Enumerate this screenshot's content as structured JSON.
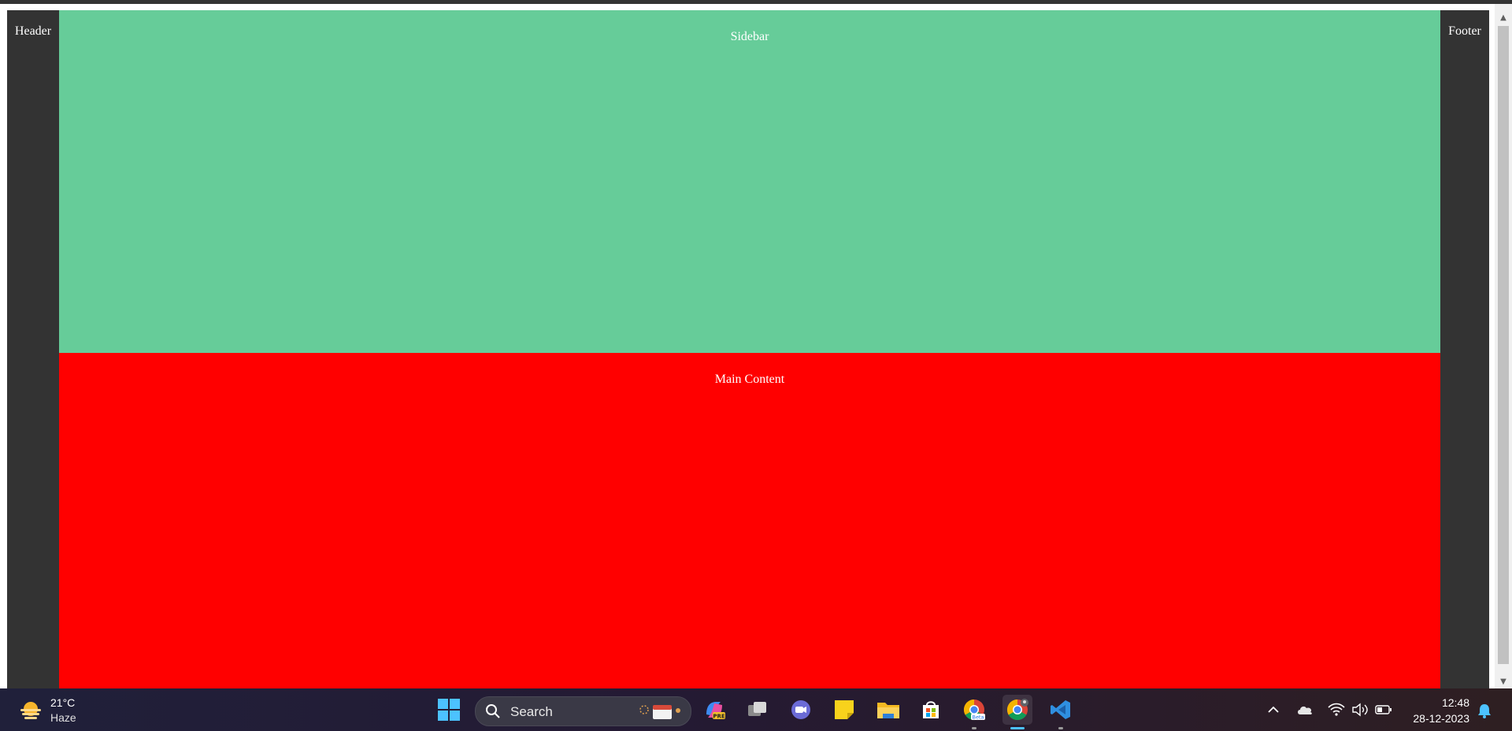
{
  "page": {
    "header_label": "Header",
    "sidebar_label": "Sidebar",
    "main_label": "Main Content",
    "footer_label": "Footer"
  },
  "taskbar": {
    "weather": {
      "temp": "21°C",
      "condition": "Haze",
      "icon": "weather-sun-haze-icon"
    },
    "search": {
      "label": "Search"
    },
    "apps": [
      {
        "name": "copilot-pre",
        "icon": "copilot-icon",
        "badge": "PRE"
      },
      {
        "name": "task-view",
        "icon": "task-view-icon"
      },
      {
        "name": "teams-chat",
        "icon": "teams-chat-icon"
      },
      {
        "name": "sticky-notes",
        "icon": "sticky-notes-icon"
      },
      {
        "name": "file-explorer",
        "icon": "folder-icon"
      },
      {
        "name": "microsoft-store",
        "icon": "store-icon"
      },
      {
        "name": "chrome-beta",
        "icon": "chrome-beta-icon",
        "badge": "Beta"
      },
      {
        "name": "chrome",
        "icon": "chrome-icon",
        "active": true
      },
      {
        "name": "vs-code",
        "icon": "vscode-icon"
      }
    ],
    "tray": {
      "time": "12:48",
      "date": "28-12-2023"
    }
  },
  "colors": {
    "frame": "#333333",
    "sidebar": "#66cc99",
    "main": "#ff0000",
    "text": "#ffffff"
  }
}
